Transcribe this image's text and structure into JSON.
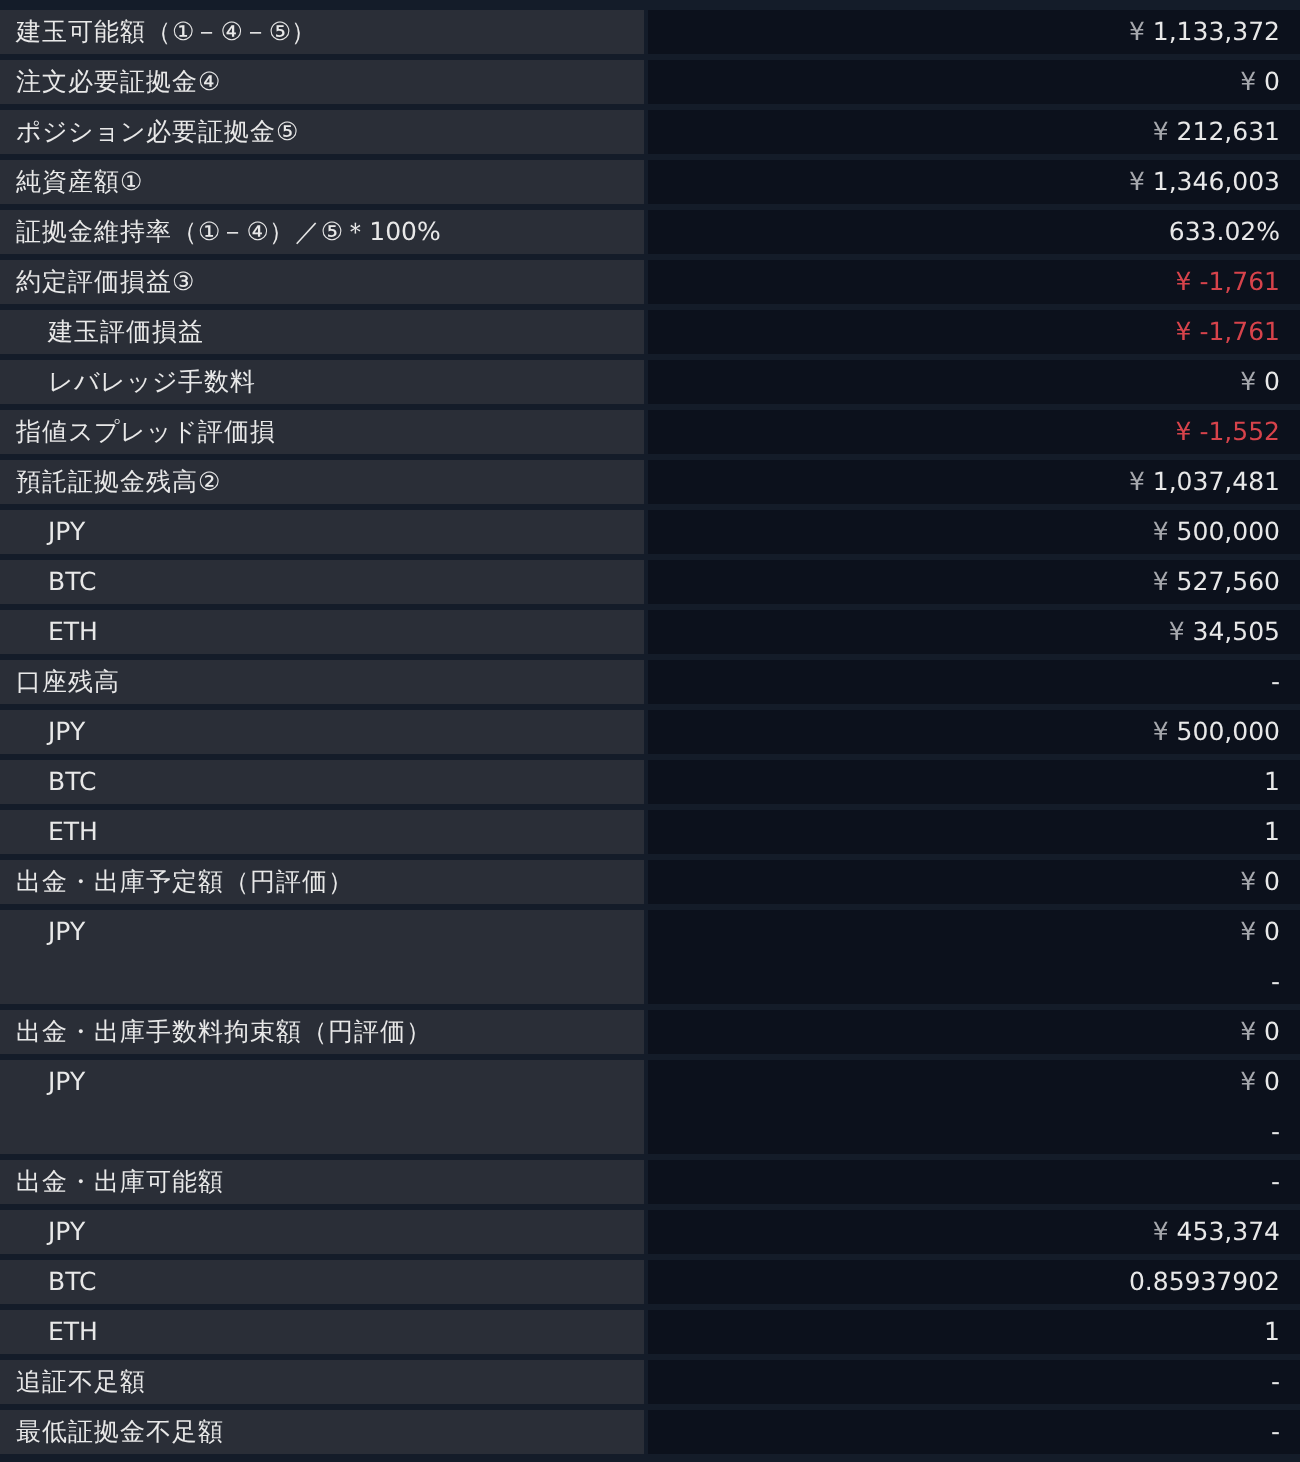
{
  "rows": [
    {
      "label": "建玉可能額（①－④－⑤）",
      "values": [
        {
          "currency": "¥",
          "amount": "1,133,372"
        }
      ],
      "negative": false
    },
    {
      "label": "注文必要証拠金④",
      "values": [
        {
          "currency": "¥",
          "amount": "0"
        }
      ],
      "negative": false
    },
    {
      "label": "ポジション必要証拠金⑤",
      "values": [
        {
          "currency": "¥",
          "amount": "212,631"
        }
      ],
      "negative": false
    },
    {
      "label": "純資産額①",
      "values": [
        {
          "currency": "¥",
          "amount": "1,346,003"
        }
      ],
      "negative": false
    },
    {
      "label": "証拠金維持率（①－④）／⑤＊100%",
      "values": [
        {
          "amount": "633.02%"
        }
      ],
      "negative": false
    },
    {
      "label": "約定評価損益③",
      "values": [
        {
          "currency": "¥",
          "amount": "-1,761"
        }
      ],
      "negative": true,
      "children": [
        {
          "label": "建玉評価損益",
          "values": [
            {
              "currency": "¥",
              "amount": "-1,761"
            }
          ],
          "negative": true
        },
        {
          "label": "レバレッジ手数料",
          "values": [
            {
              "currency": "¥",
              "amount": "0"
            }
          ],
          "negative": false
        }
      ]
    },
    {
      "label": "指値スプレッド評価損",
      "values": [
        {
          "currency": "¥",
          "amount": "-1,552"
        }
      ],
      "negative": true
    },
    {
      "label": "預託証拠金残高②",
      "values": [
        {
          "currency": "¥",
          "amount": "1,037,481"
        }
      ],
      "negative": false,
      "children": [
        {
          "label": "JPY",
          "values": [
            {
              "currency": "¥",
              "amount": "500,000"
            }
          ],
          "negative": false
        },
        {
          "label": "BTC",
          "values": [
            {
              "currency": "¥",
              "amount": "527,560"
            }
          ],
          "negative": false
        },
        {
          "label": "ETH",
          "values": [
            {
              "currency": "¥",
              "amount": "34,505"
            }
          ],
          "negative": false
        }
      ]
    },
    {
      "label": "口座残高",
      "values": [
        {
          "amount": "-"
        }
      ],
      "negative": false,
      "children": [
        {
          "label": "JPY",
          "values": [
            {
              "currency": "¥",
              "amount": "500,000"
            }
          ],
          "negative": false
        },
        {
          "label": "BTC",
          "values": [
            {
              "amount": "1"
            }
          ],
          "negative": false
        },
        {
          "label": "ETH",
          "values": [
            {
              "amount": "1"
            }
          ],
          "negative": false
        }
      ]
    },
    {
      "label": "出金・出庫予定額（円評価）",
      "values": [
        {
          "currency": "¥",
          "amount": "0"
        }
      ],
      "negative": false,
      "children": [
        {
          "label": "JPY",
          "values": [
            {
              "currency": "¥",
              "amount": "0"
            },
            {
              "amount": "-"
            }
          ],
          "negative": false
        }
      ]
    },
    {
      "label": "出金・出庫手数料拘束額（円評価）",
      "values": [
        {
          "currency": "¥",
          "amount": "0"
        }
      ],
      "negative": false,
      "children": [
        {
          "label": "JPY",
          "values": [
            {
              "currency": "¥",
              "amount": "0"
            },
            {
              "amount": "-"
            }
          ],
          "negative": false
        }
      ]
    },
    {
      "label": "出金・出庫可能額",
      "values": [
        {
          "amount": "-"
        }
      ],
      "negative": false,
      "children": [
        {
          "label": "JPY",
          "values": [
            {
              "currency": "¥",
              "amount": "453,374"
            }
          ],
          "negative": false
        },
        {
          "label": "BTC",
          "values": [
            {
              "amount": "0.85937902"
            }
          ],
          "negative": false
        },
        {
          "label": "ETH",
          "values": [
            {
              "amount": "1"
            }
          ],
          "negative": false
        }
      ]
    },
    {
      "label": "追証不足額",
      "values": [
        {
          "amount": "-"
        }
      ],
      "negative": false
    },
    {
      "label": "最低証拠金不足額",
      "values": [
        {
          "amount": "-"
        }
      ],
      "negative": false
    }
  ]
}
